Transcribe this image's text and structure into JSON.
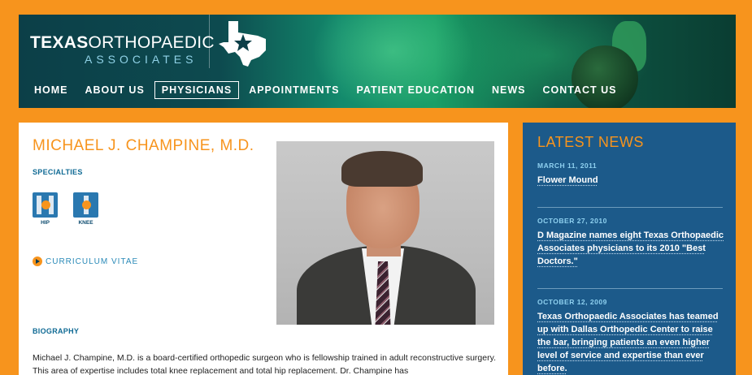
{
  "header": {
    "logo": {
      "line1_bold": "TEXAS",
      "line1_rest": "ORTHOPAEDIC",
      "line2": "ASSOCIATES"
    },
    "nav": [
      {
        "label": "HOME",
        "active": false
      },
      {
        "label": "ABOUT US",
        "active": false
      },
      {
        "label": "PHYSICIANS",
        "active": true
      },
      {
        "label": "APPOINTMENTS",
        "active": false
      },
      {
        "label": "PATIENT EDUCATION",
        "active": false
      },
      {
        "label": "NEWS",
        "active": false
      },
      {
        "label": "CONTACT US",
        "active": false
      }
    ]
  },
  "main": {
    "doctor_name": "MICHAEL J. CHAMPINE, M.D.",
    "specialties_label": "SPECIALTIES",
    "specialties": [
      {
        "label": "HIP",
        "icon": "hip-icon"
      },
      {
        "label": "KNEE",
        "icon": "knee-icon"
      }
    ],
    "cv_label": "CURRICULUM VITAE",
    "biography_label": "BIOGRAPHY",
    "biography_text": "Michael J. Champine, M.D. is a board-certified orthopedic surgeon who is fellowship trained in adult reconstructive surgery.  This area of expertise includes total knee replacement and total hip replacement.  Dr. Champine has"
  },
  "sidebar": {
    "title": "LATEST NEWS",
    "items": [
      {
        "date": "MARCH 11, 2011",
        "headline": "Flower Mound"
      },
      {
        "date": "OCTOBER 27, 2010",
        "headline": "D Magazine names eight Texas Orthopaedic Associates physicians to its 2010 \"Best Doctors.\""
      },
      {
        "date": "OCTOBER 12, 2009",
        "headline": "Texas Orthopaedic Associates has teamed up with Dallas Orthopedic Center to raise the bar, bringing patients an even higher level of service and expertise than ever before."
      }
    ]
  },
  "colors": {
    "page_background": "#f7941d",
    "accent_orange": "#f7941d",
    "sidebar_blue": "#1c5a8a",
    "label_blue": "#0f6a94"
  }
}
